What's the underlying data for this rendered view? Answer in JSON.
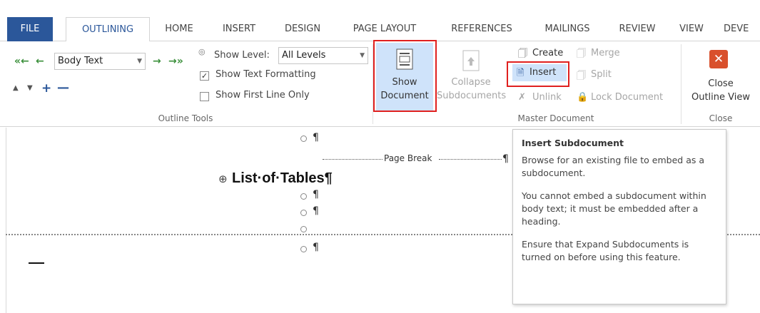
{
  "tabs": [
    "FILE",
    "OUTLINING",
    "HOME",
    "INSERT",
    "DESIGN",
    "PAGE LAYOUT",
    "REFERENCES",
    "MAILINGS",
    "REVIEW",
    "VIEW",
    "DEVE"
  ],
  "outline_tools": {
    "level_value": "Body Text",
    "show_level_label": "Show Level:",
    "show_level_value": "All Levels",
    "show_text_formatting": "Show Text Formatting",
    "show_text_formatting_checked": true,
    "show_first_line_only": "Show First Line Only",
    "show_first_line_only_checked": false,
    "group_label": "Outline Tools"
  },
  "master_document": {
    "show_document": [
      "Show",
      "Document"
    ],
    "collapse_subdocuments": [
      "Collapse",
      "Subdocuments"
    ],
    "create": "Create",
    "insert": "Insert",
    "unlink": "Unlink",
    "merge": "Merge",
    "split": "Split",
    "lock_document": "Lock Document",
    "group_label": "Master Document"
  },
  "close_group": {
    "close_outline_view": [
      "Close",
      "Outline View"
    ],
    "group_label": "Close"
  },
  "document": {
    "page_break": "Page Break",
    "heading": "List·of·Tables¶",
    "pilcrow": "¶"
  },
  "tooltip": {
    "title": "Insert Subdocument",
    "paragraphs": [
      "Browse for an existing file to embed as a subdocument.",
      "You cannot embed a subdocument within body text; it must be embedded after a heading.",
      "Ensure that Expand Subdocuments is turned on before using this feature."
    ]
  },
  "colors": {
    "file_tab": "#2b579a",
    "highlight": "#cfe3fa",
    "callout_red": "#e0201f",
    "close_icon": "#d9502c"
  }
}
